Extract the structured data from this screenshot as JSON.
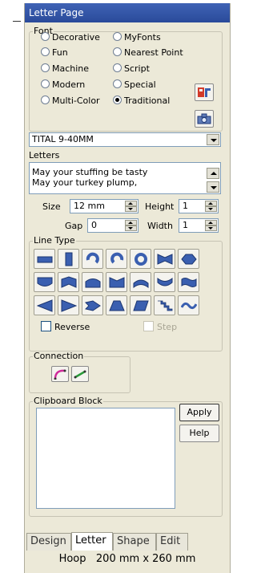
{
  "window": {
    "title": "Letter Page"
  },
  "font": {
    "legend": "Font",
    "options": [
      "Decorative",
      "MyFonts",
      "Fun",
      "Nearest Point",
      "Machine",
      "Script",
      "Modern",
      "Special",
      "Multi-Color",
      "Traditional"
    ],
    "selected": "Traditional",
    "dropdown_value": "TITAL 9-40MM"
  },
  "letters": {
    "label": "Letters",
    "lines": [
      "May your stuffing be tasty",
      "May your turkey plump,"
    ]
  },
  "fields": {
    "size_label": "Size",
    "size_value": "12 mm",
    "height_label": "Height",
    "height_value": "1",
    "gap_label": "Gap",
    "gap_value": "0",
    "width_label": "Width",
    "width_value": "1"
  },
  "line_type": {
    "legend": "Line Type",
    "reverse_label": "Reverse",
    "reverse_checked": false,
    "step_label": "Step",
    "step_enabled": false
  },
  "connection": {
    "legend": "Connection"
  },
  "clipboard": {
    "legend": "Clipboard Block",
    "apply_label": "Apply",
    "help_label": "Help"
  },
  "tabs": [
    "Design",
    "Letter",
    "Shape",
    "Edit"
  ],
  "active_tab": "Letter",
  "status": {
    "text": "Hoop   200 mm x 260 mm"
  },
  "colors": {
    "title_bar": "#2a4a9a",
    "panel_bg": "#ece9d8",
    "icon_blue": "#3a5fb0",
    "icon_red": "#d23a2a"
  }
}
